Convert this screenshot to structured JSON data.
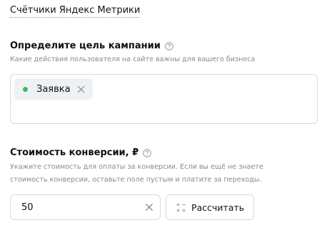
{
  "counters_link": "Счётчики Яндекс Метрики",
  "goal_section": {
    "title": "Определите цель кампании",
    "hint": "Какие действия пользователя на сайте важны для вашего бизнеса",
    "goals": [
      {
        "label": "Заявка",
        "status_color": "#3fb950"
      }
    ]
  },
  "conversion_section": {
    "title": "Стоимость конверсии, ₽",
    "hint_line1": "Укажите стоимость для оплаты за конверсии. Если вы ещё не знаете",
    "hint_line2": "стоимость конверсии, оставьте поле пустым и платите за переходы.",
    "value": "50",
    "calculate_label": "Рассчитать"
  },
  "icons": {
    "help": "question-circle-icon",
    "remove": "close-icon",
    "clear": "close-icon",
    "calculate": "calculator-icon"
  }
}
